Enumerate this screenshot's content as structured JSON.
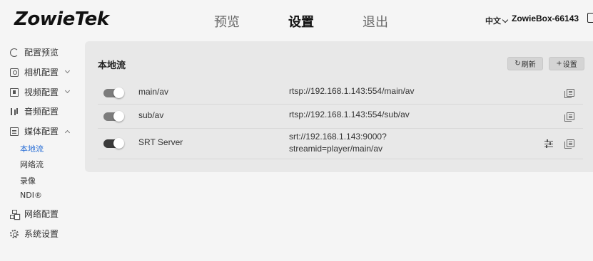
{
  "header": {
    "logo": "ZowieTek",
    "tabs": [
      {
        "label": "预览",
        "active": false
      },
      {
        "label": "设置",
        "active": true
      },
      {
        "label": "退出",
        "active": false
      }
    ],
    "language": "中文",
    "device_name": "ZowieBox-66143"
  },
  "sidebar": {
    "items": [
      {
        "label": "配置预览",
        "icon": "dial-icon"
      },
      {
        "label": "相机配置",
        "icon": "camera-icon",
        "expandable": true
      },
      {
        "label": "视频配置",
        "icon": "film-icon",
        "expandable": true
      },
      {
        "label": "音频配置",
        "icon": "audio-icon"
      },
      {
        "label": "媒体配置",
        "icon": "media-icon",
        "expanded": true
      },
      {
        "label": "网络配置",
        "icon": "network-icon"
      },
      {
        "label": "系统设置",
        "icon": "gear-icon"
      }
    ],
    "media_sub": [
      {
        "label": "本地流",
        "active": true
      },
      {
        "label": "网络流",
        "active": false
      },
      {
        "label": "录像",
        "active": false
      },
      {
        "label": "NDI®",
        "active": false
      }
    ]
  },
  "main": {
    "title": "本地流",
    "refresh_label": "刷新",
    "settings_label": "设置",
    "streams": [
      {
        "name": "main/av",
        "url": "rtsp://192.168.1.143:554/main/av",
        "enabled": true
      },
      {
        "name": "sub/av",
        "url": "rtsp://192.168.1.143:554/sub/av",
        "enabled": true
      },
      {
        "name": "SRT Server",
        "url_line1": "srt://192.168.1.143:9000?",
        "url_line2": "streamid=player/main/av",
        "enabled": true
      }
    ]
  },
  "colors": {
    "accent": "#2a6fd6",
    "card_bg": "#e8e8e8",
    "page_bg": "#f5f5f5"
  }
}
